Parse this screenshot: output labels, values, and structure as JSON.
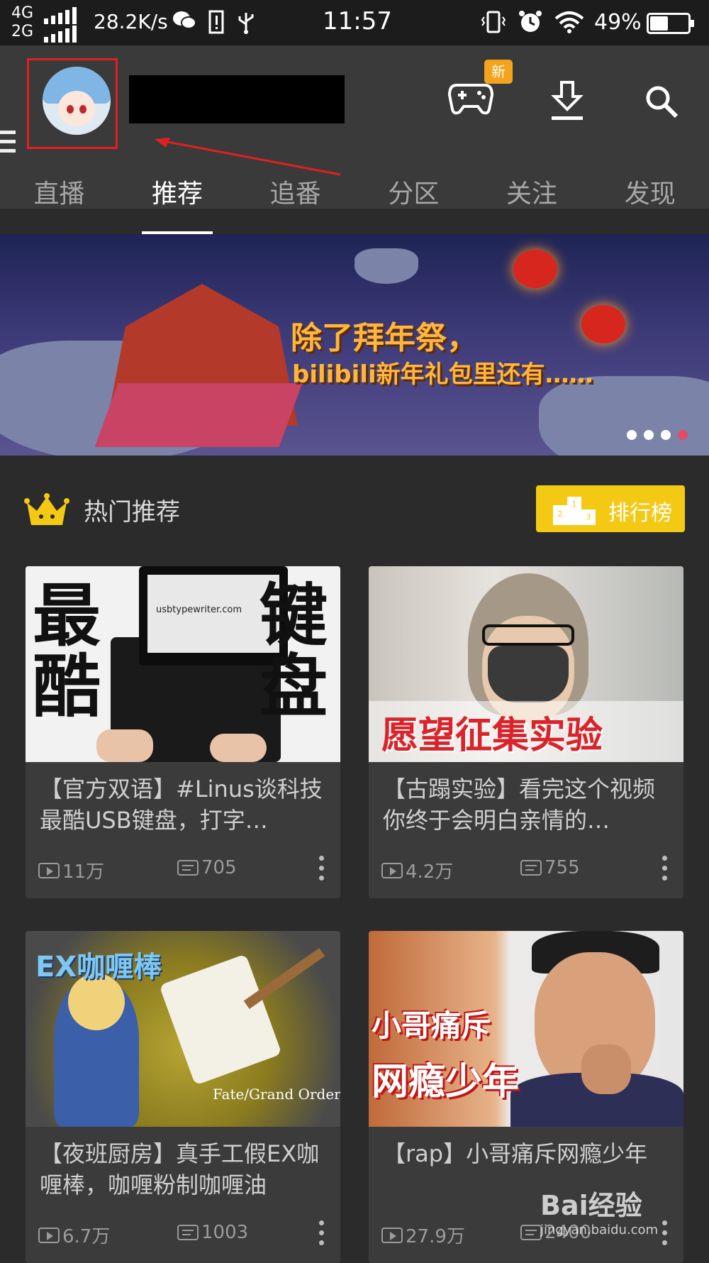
{
  "status_bar": {
    "network_top": "4G",
    "network_bottom": "2G",
    "speed": "28.2K/s",
    "time": "11:57",
    "battery": "49%",
    "battery_level": 0.49
  },
  "header": {
    "new_badge": "新"
  },
  "tabs": [
    {
      "label": "直播"
    },
    {
      "label": "推荐"
    },
    {
      "label": "追番"
    },
    {
      "label": "分区"
    },
    {
      "label": "关注"
    },
    {
      "label": "发现"
    }
  ],
  "active_tab": "推荐",
  "banner": {
    "title": "除了拜年祭，",
    "subtitle": "bilibili新年礼包里还有……",
    "dots": 4,
    "active_dot": 4
  },
  "section": {
    "title": "热门推荐",
    "rank_button": "排行榜",
    "podium_numbers": [
      "1",
      "2",
      "3"
    ]
  },
  "cards": [
    {
      "thumb_left": "最酷",
      "thumb_right": "键盘",
      "thumb_screen": "usbtypewriter.com",
      "title": "【官方双语】#Linus谈科技 最酷USB键盘，打字…",
      "views": "11万",
      "danmaku": "705"
    },
    {
      "thumb_text": "愿望征集实验",
      "title": "【古蹋实验】看完这个视频你终于会明白亲情的…",
      "views": "4.2万",
      "danmaku": "755"
    },
    {
      "thumb_text": "EX咖喱棒",
      "thumb_logo": "Fate/Grand Order",
      "title": "【夜班厨房】真手工假EX咖喱棒，咖喱粉制咖喱油",
      "views": "6.7万",
      "danmaku": "1003"
    },
    {
      "thumb_text_1": "小哥痛斥",
      "thumb_text_2": "网瘾少年",
      "title": "【rap】小哥痛斥网瘾少年",
      "views": "27.9万",
      "danmaku": "2400"
    }
  ],
  "watermark": {
    "brand": "Bai经验",
    "url": "jingyan.baidu.com"
  },
  "colors": {
    "accent_yellow": "#f4c914",
    "badge_orange": "#f5a31c",
    "highlight_red": "#e02020",
    "active_dot": "#e24c64"
  }
}
